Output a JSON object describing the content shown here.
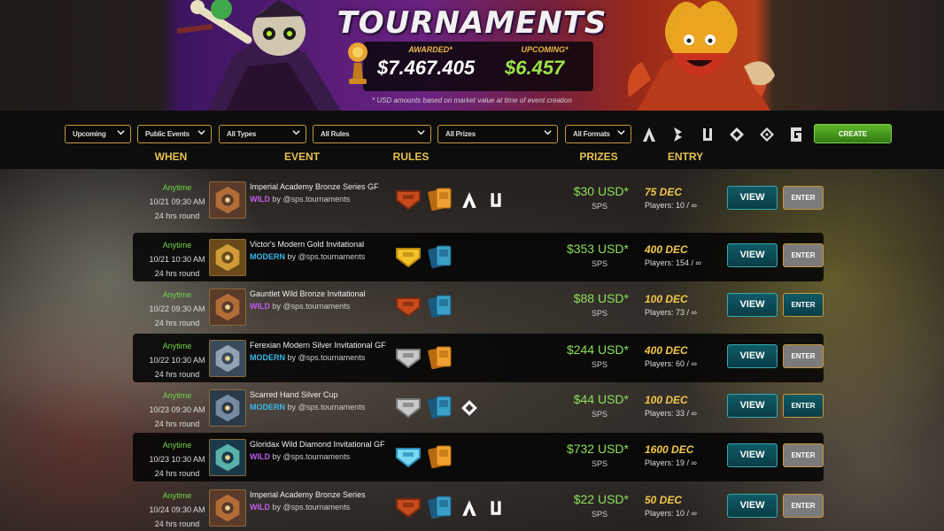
{
  "header": {
    "title": "TOURNAMENTS",
    "awarded_label": "AWARDED*",
    "awarded_value": "$7.467.405",
    "upcoming_label": "UPCOMING*",
    "upcoming_value": "$6.457",
    "note": "* USD amounts based on market value at time of event creation"
  },
  "filters": {
    "when": "Upcoming",
    "events": "Public Events",
    "types": "All Types",
    "rules": "All Rules",
    "prizes": "All Prizes",
    "formats": "All Formats",
    "create_label": "CREATE",
    "format_icons": [
      "wild-format-icon",
      "modern-format-icon",
      "survival-format-icon",
      "foundation-format-icon",
      "open-format-icon",
      "guild-format-icon"
    ]
  },
  "columns": {
    "when": "WHEN",
    "event": "EVENT",
    "rules": "RULES",
    "prizes": "PRIZES",
    "entry": "ENTRY"
  },
  "buttons": {
    "view": "VIEW",
    "enter": "ENTER"
  },
  "colors": {
    "wild": "#c05cf0",
    "modern": "#3ab8e8",
    "prize_usd": "#8ce05a",
    "entry_fee": "#f2c84a",
    "anytime": "#6fd64a",
    "gold_border": "#c59a3a"
  },
  "rows": [
    {
      "anytime": "Anytime",
      "datetime": "10/21 09:30 AM",
      "round": "24 hrs round",
      "name": "Imperial Academy Bronze Series GF",
      "format": "WILD",
      "by": "by @sps.tournaments",
      "league": "bronze",
      "cards": "orange",
      "extras": [
        "wild-icon",
        "survival-icon"
      ],
      "prize": "$30 USD*",
      "token": "SPS",
      "fee": "75 DEC",
      "players": "Players: 10 / ∞",
      "enter_style": "grey",
      "logo": "academy"
    },
    {
      "anytime": "Anytime",
      "datetime": "10/21 10:30 AM",
      "round": "24 hrs round",
      "name": "Victor's Modern Gold Invitational",
      "format": "MODERN",
      "by": "by @sps.tournaments",
      "league": "gold",
      "cards": "blue",
      "extras": [],
      "prize": "$353 USD*",
      "token": "SPS",
      "fee": "400 DEC",
      "players": "Players: 154 / ∞",
      "enter_style": "grey",
      "logo": "victor"
    },
    {
      "anytime": "Anytime",
      "datetime": "10/22 09:30 AM",
      "round": "24 hrs round",
      "name": "Gauntlet Wild Bronze Invitational",
      "format": "WILD",
      "by": "by @sps.tournaments",
      "league": "bronze",
      "cards": "blue",
      "extras": [],
      "prize": "$88 USD*",
      "token": "SPS",
      "fee": "100 DEC",
      "players": "Players: 73 / ∞",
      "enter_style": "teal",
      "logo": "academy"
    },
    {
      "anytime": "Anytime",
      "datetime": "10/22 10:30 AM",
      "round": "24 hrs round",
      "name": "Ferexian Modern Silver Invitational GF",
      "format": "MODERN",
      "by": "by @sps.tournaments",
      "league": "silver",
      "cards": "orange",
      "extras": [],
      "prize": "$244 USD*",
      "token": "SPS",
      "fee": "400 DEC",
      "players": "Players: 60 / ∞",
      "enter_style": "grey",
      "logo": "ferexian"
    },
    {
      "anytime": "Anytime",
      "datetime": "10/23 09:30 AM",
      "round": "24 hrs round",
      "name": "Scarred Hand Silver Cup",
      "format": "MODERN",
      "by": "by @sps.tournaments",
      "league": "silver",
      "cards": "blue",
      "extras": [
        "foundation-icon"
      ],
      "prize": "$44 USD*",
      "token": "SPS",
      "fee": "100 DEC",
      "players": "Players: 33 / ∞",
      "enter_style": "teal",
      "logo": "scarred"
    },
    {
      "anytime": "Anytime",
      "datetime": "10/23 10:30 AM",
      "round": "24 hrs round",
      "name": "Gloridax Wild Diamond Invitational GF",
      "format": "WILD",
      "by": "by @sps.tournaments",
      "league": "diamond",
      "cards": "orange",
      "extras": [],
      "prize": "$732 USD*",
      "token": "SPS",
      "fee": "1600 DEC",
      "players": "Players: 19 / ∞",
      "enter_style": "grey",
      "logo": "gloridax"
    },
    {
      "anytime": "Anytime",
      "datetime": "10/24 09:30 AM",
      "round": "24 hrs round",
      "name": "Imperial Academy Bronze Series",
      "format": "WILD",
      "by": "by @sps.tournaments",
      "league": "bronze",
      "cards": "blue",
      "extras": [
        "wild-icon",
        "survival-icon"
      ],
      "prize": "$22 USD*",
      "token": "SPS",
      "fee": "50 DEC",
      "players": "Players: 10 / ∞",
      "enter_style": "grey",
      "logo": "academy"
    }
  ]
}
